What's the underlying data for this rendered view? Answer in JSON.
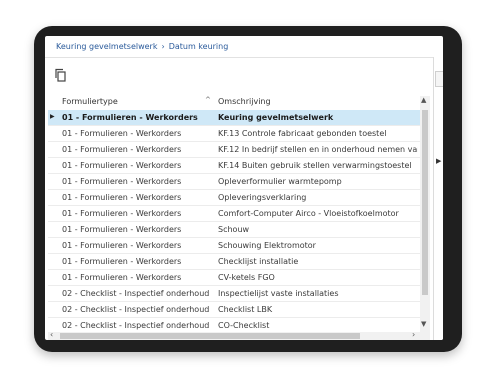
{
  "breadcrumb": {
    "parent": "Keuring gevelmetselwerk",
    "separator": "›",
    "current": "Datum keuring"
  },
  "toolbar": {
    "copy_icon": "copy-icon"
  },
  "grid": {
    "columns": [
      "Formuliertype",
      "Omschrijving"
    ],
    "sort_indicator": "^",
    "rows": [
      {
        "type": "01 - Formulieren - Werkorders",
        "desc": "Keuring gevelmetselwerk",
        "selected": true
      },
      {
        "type": "01 - Formulieren - Werkorders",
        "desc": "KF.13 Controle fabricaat gebonden toestel"
      },
      {
        "type": "01 - Formulieren - Werkorders",
        "desc": "KF.12 In bedrijf stellen en in onderhoud nemen van"
      },
      {
        "type": "01 - Formulieren - Werkorders",
        "desc": "KF.14 Buiten gebruik stellen verwarmingstoestel"
      },
      {
        "type": "01 - Formulieren - Werkorders",
        "desc": "Opleverformulier warmtepomp"
      },
      {
        "type": "01 - Formulieren - Werkorders",
        "desc": "Opleveringsverklaring"
      },
      {
        "type": "01 - Formulieren - Werkorders",
        "desc": "Comfort-Computer Airco - Vloeistofkoelmotor"
      },
      {
        "type": "01 - Formulieren - Werkorders",
        "desc": "Schouw"
      },
      {
        "type": "01 - Formulieren - Werkorders",
        "desc": "Schouwing Elektromotor"
      },
      {
        "type": "01 - Formulieren - Werkorders",
        "desc": "Checklijst installatie"
      },
      {
        "type": "01 - Formulieren - Werkorders",
        "desc": "CV-ketels FGO"
      },
      {
        "type": "02 - Checklist - Inspectief onderhoud",
        "desc": "Inspectielijst vaste installaties"
      },
      {
        "type": "02 - Checklist - Inspectief onderhoud",
        "desc": "Checklist LBK"
      },
      {
        "type": "02 - Checklist - Inspectief onderhoud",
        "desc": "CO-Checklist"
      }
    ]
  },
  "colors": {
    "accent": "#2b5b9b",
    "selection": "#cfe8f7"
  }
}
